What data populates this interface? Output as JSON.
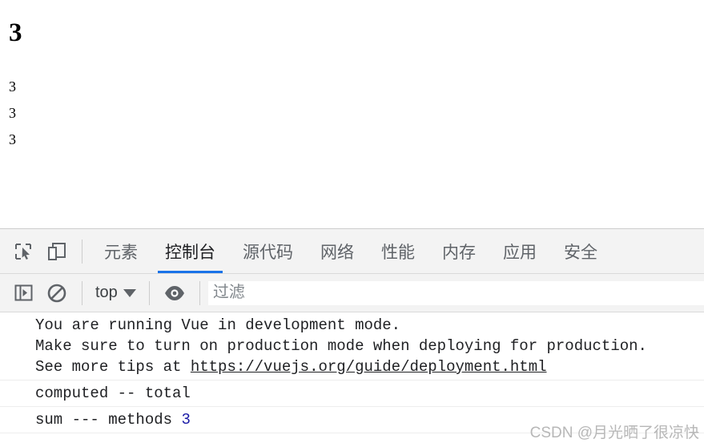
{
  "page": {
    "heading": "3",
    "lines": [
      "3",
      "3",
      "3"
    ]
  },
  "devtools": {
    "toolbar_icons": [
      {
        "name": "inspect-element-icon",
        "title": "检查元素"
      },
      {
        "name": "device-toolbar-icon",
        "title": "切换设备工具栏"
      }
    ],
    "tabs": [
      {
        "label": "元素",
        "active": false
      },
      {
        "label": "控制台",
        "active": true
      },
      {
        "label": "源代码",
        "active": false
      },
      {
        "label": "网络",
        "active": false
      },
      {
        "label": "性能",
        "active": false
      },
      {
        "label": "内存",
        "active": false
      },
      {
        "label": "应用",
        "active": false
      },
      {
        "label": "安全",
        "active": false
      }
    ],
    "filterbar": {
      "sidebar_toggle_title": "显示控制台边栏",
      "clear_console_title": "清除控制台",
      "context_label": "top",
      "eye_title": "创建实时表达式",
      "filter_placeholder": "过滤",
      "filter_value": ""
    },
    "console_groups": [
      {
        "lines": [
          {
            "text": "You are running Vue in development mode."
          },
          {
            "text": "Make sure to turn on production mode when deploying for production."
          },
          {
            "prefix": "See more tips at ",
            "link": "https://vuejs.org/guide/deployment.html"
          }
        ]
      },
      {
        "lines": [
          {
            "text": "computed -- total"
          }
        ]
      },
      {
        "lines": [
          {
            "prefix": "sum --- methods ",
            "number": "3"
          }
        ]
      }
    ]
  },
  "watermark": "CSDN @月光晒了很凉快",
  "colors": {
    "accent": "#1a73e8",
    "toolbar_bg": "#f3f3f3",
    "number_token": "#1a1aa6",
    "text": "#202124"
  }
}
